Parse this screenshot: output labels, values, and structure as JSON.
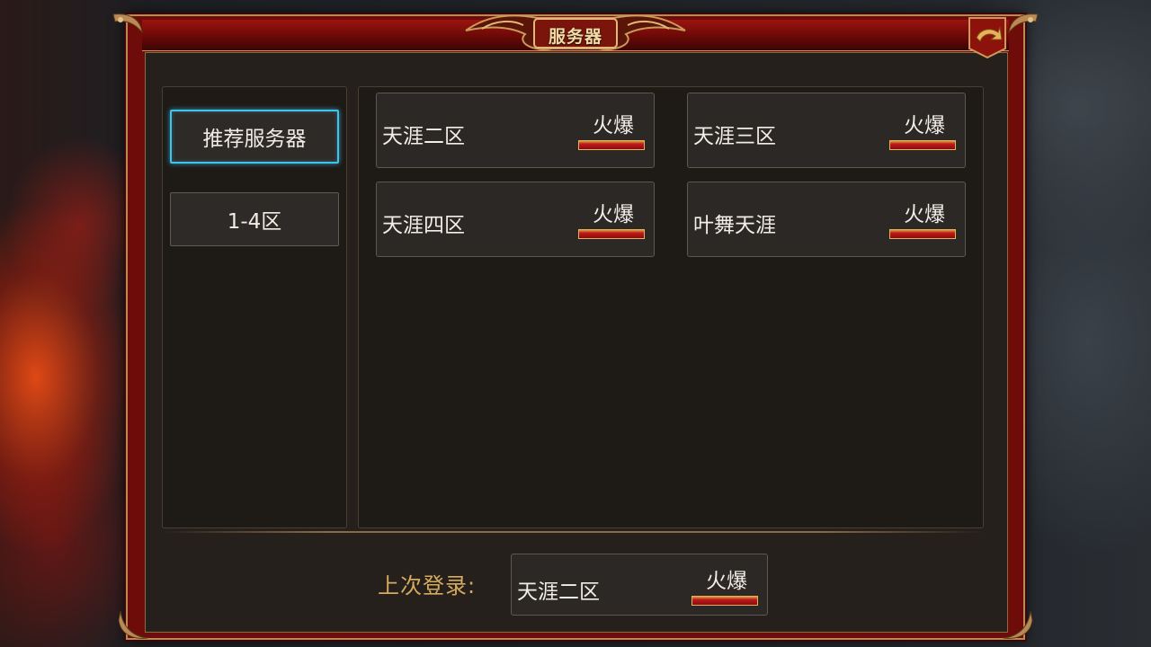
{
  "window": {
    "title": "服务器"
  },
  "categories": [
    {
      "label": "推荐服务器",
      "active": true
    },
    {
      "label": "1-4区",
      "active": false
    }
  ],
  "servers": [
    {
      "name": "天涯二区",
      "status": "火爆"
    },
    {
      "name": "天涯三区",
      "status": "火爆"
    },
    {
      "name": "天涯四区",
      "status": "火爆"
    },
    {
      "name": "叶舞天涯",
      "status": "火爆"
    }
  ],
  "last_login": {
    "label": "上次登录:",
    "server": {
      "name": "天涯二区",
      "status": "火爆"
    }
  },
  "colors": {
    "frame_red": "#6d0c08",
    "panel_bg": "#25201b",
    "active_border": "#3ec3ee",
    "gold_text": "#d6ab5e",
    "status_bar": "#c11a1c"
  },
  "icons": {
    "back": "back-arrow-icon"
  }
}
